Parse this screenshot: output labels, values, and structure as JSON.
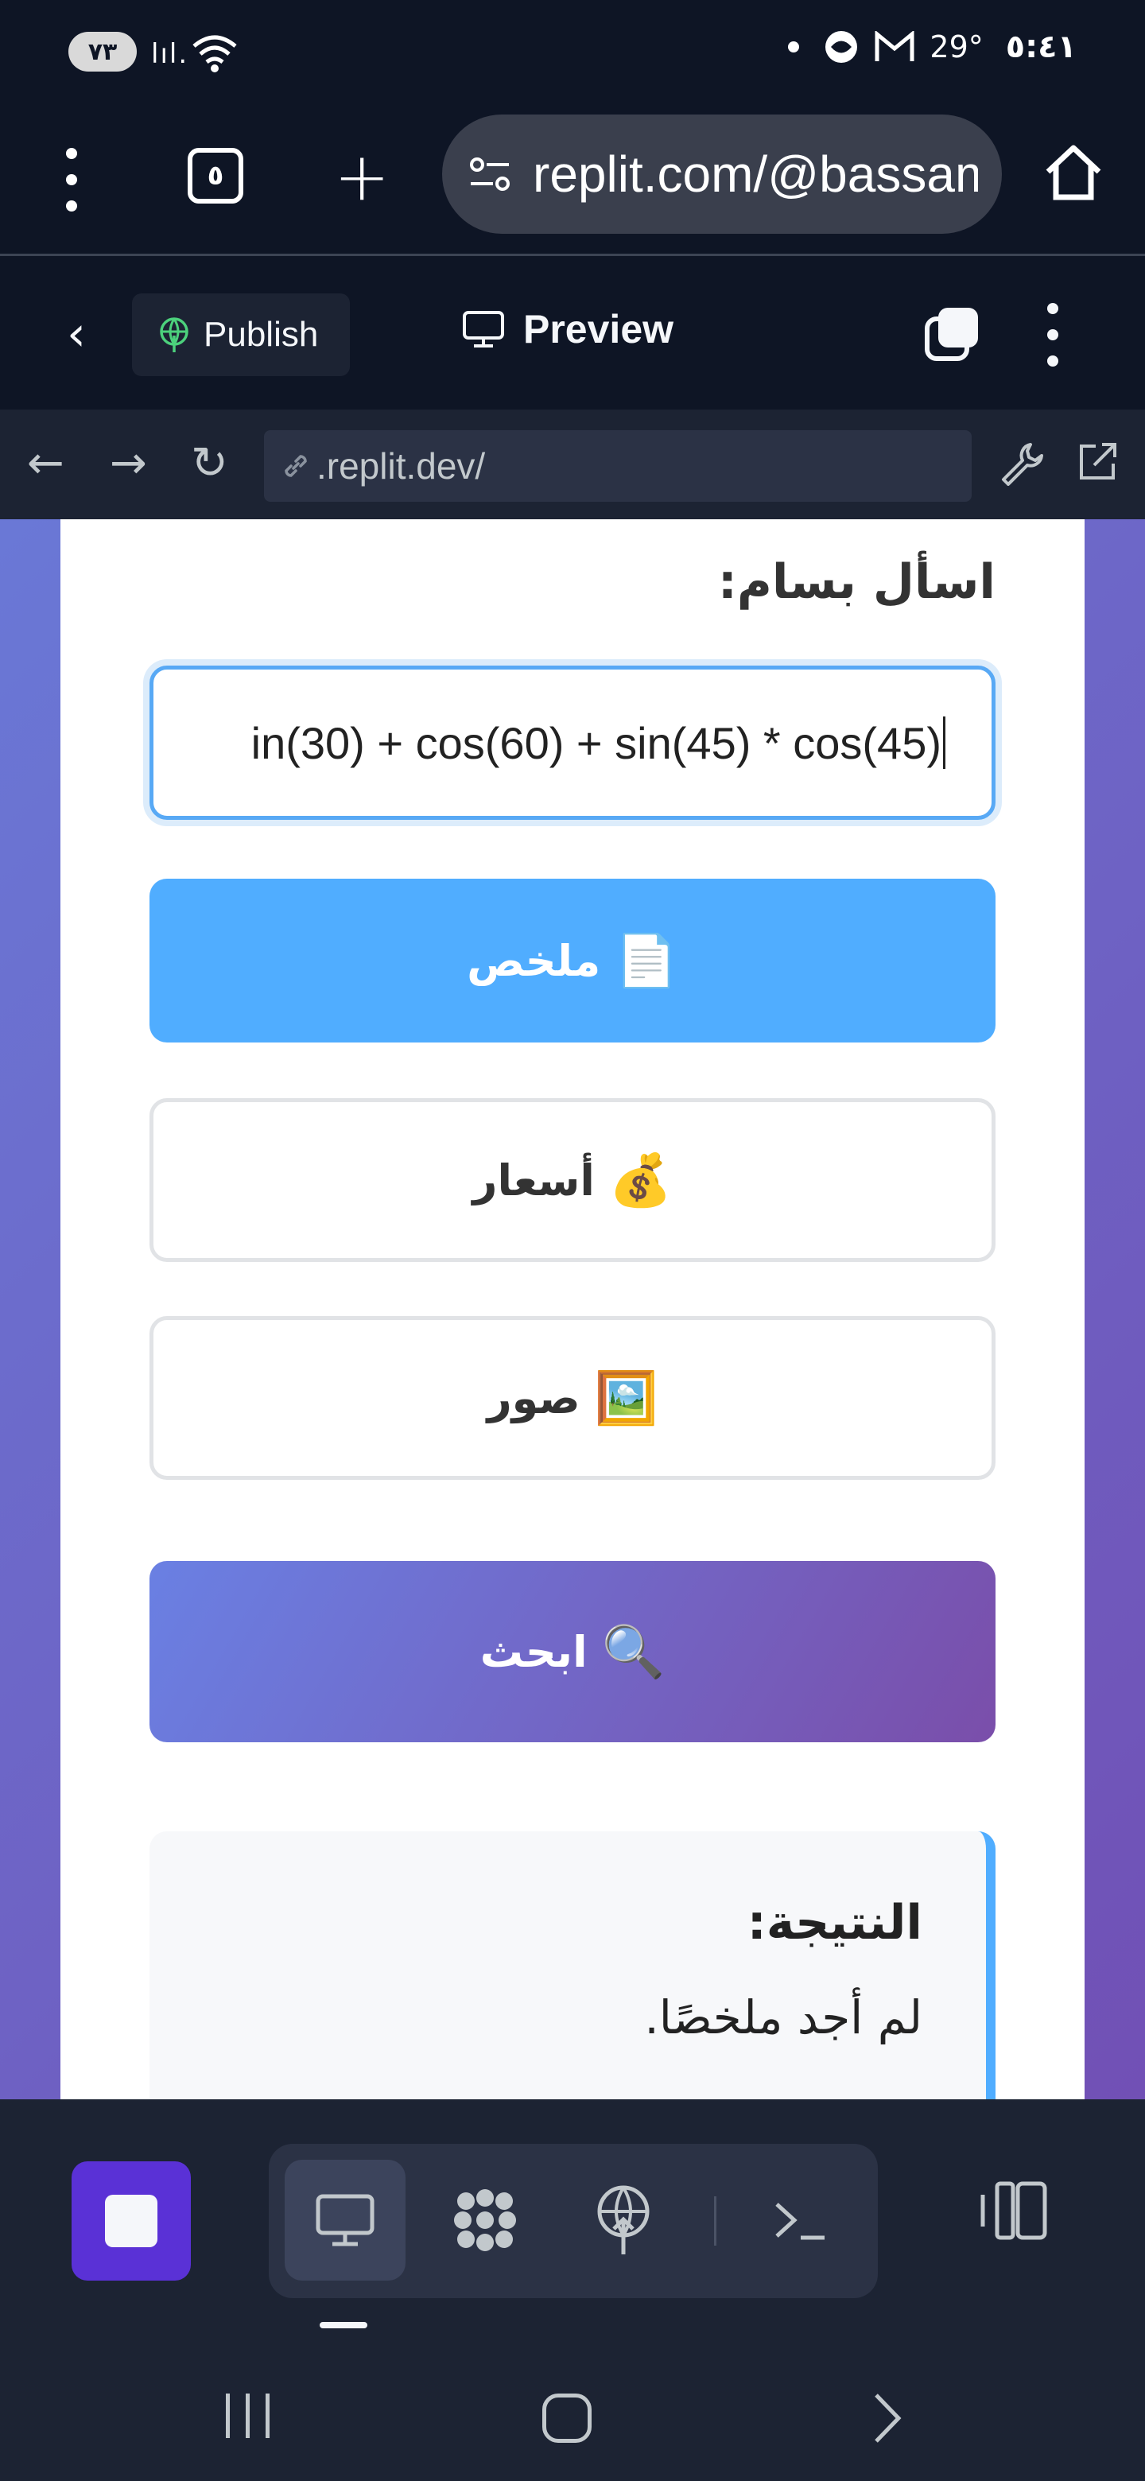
{
  "status_bar": {
    "battery": "٧٣",
    "temperature": "29°",
    "time": "٥:٤١"
  },
  "browser": {
    "tab_count": "٥",
    "url": "replit.com/@bassam"
  },
  "replit_header": {
    "publish_label": "Publish",
    "preview_label": "Preview"
  },
  "webview_toolbar": {
    "address": ".replit.dev/"
  },
  "page": {
    "ask_label": "اسأل بسام:",
    "query_value": "in(30) + cos(60) + sin(45) * cos(45)",
    "summary_button": "ملخص",
    "summary_emoji": "📄",
    "prices_button": "أسعار",
    "prices_emoji": "💰",
    "images_button": "صور",
    "images_emoji": "🖼️",
    "search_button": "ابحث",
    "search_emoji": "🔍",
    "result_title": "النتيجة:",
    "result_text": "لم أجد ملخصًا."
  },
  "colors": {
    "accent_blue": "#50adff",
    "purple_gradient_start": "#6a80e3",
    "purple_gradient_end": "#7a4eaa",
    "stop_button": "#5a31d6"
  }
}
